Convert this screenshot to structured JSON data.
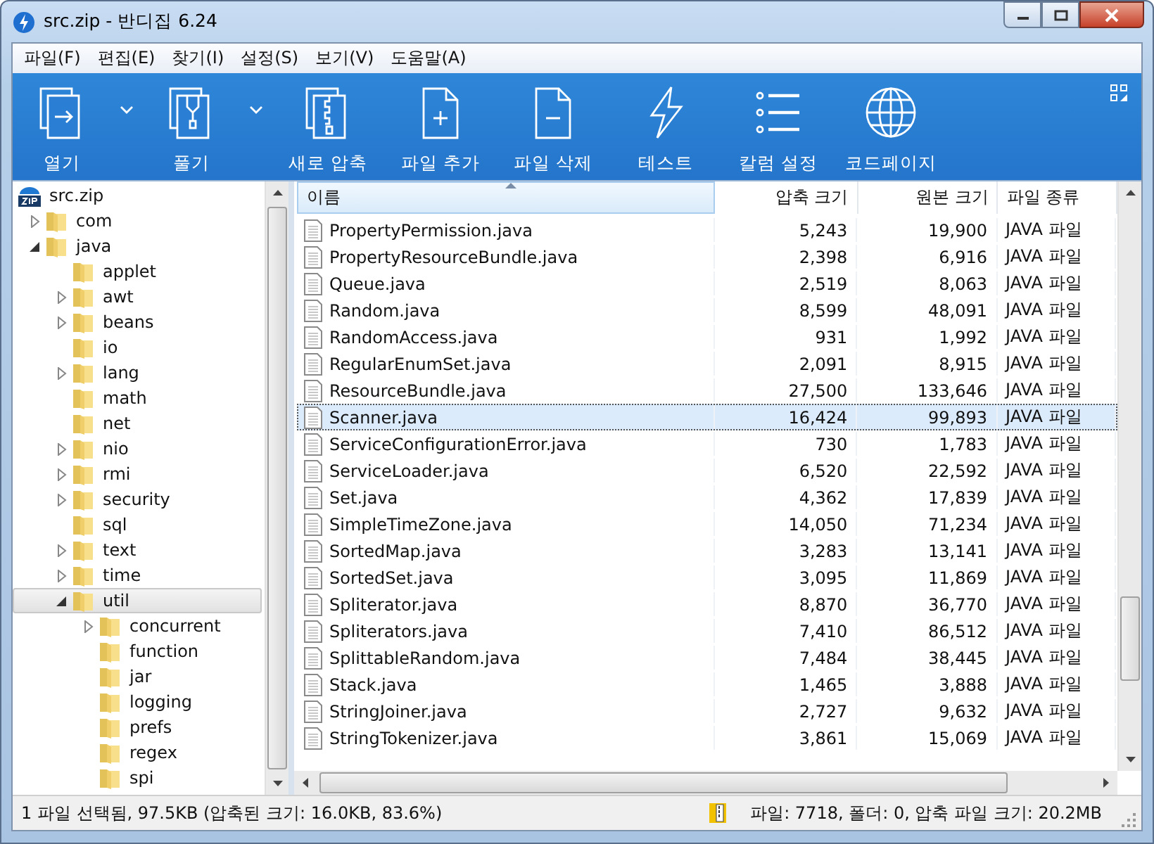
{
  "window": {
    "title": "src.zip - 반디집 6.24"
  },
  "menu": [
    "파일(F)",
    "편집(E)",
    "찾기(I)",
    "설정(S)",
    "보기(V)",
    "도움말(A)"
  ],
  "toolbar": [
    {
      "label": "열기",
      "kind": "open",
      "dropdown": true
    },
    {
      "label": "풀기",
      "kind": "extract",
      "dropdown": true
    },
    {
      "label": "새로 압축",
      "kind": "new",
      "dropdown": false
    },
    {
      "label": "파일 추가",
      "kind": "add",
      "dropdown": false
    },
    {
      "label": "파일 삭제",
      "kind": "delete",
      "dropdown": false
    },
    {
      "label": "테스트",
      "kind": "test",
      "dropdown": false
    },
    {
      "label": "칼럼 설정",
      "kind": "columns",
      "dropdown": false
    },
    {
      "label": "코드페이지",
      "kind": "codepage",
      "dropdown": false
    }
  ],
  "tree": {
    "label": "src.zip",
    "children": [
      {
        "label": "com",
        "has_children": true,
        "expanded": false,
        "selected": false
      },
      {
        "label": "java",
        "has_children": true,
        "expanded": true,
        "selected": false,
        "children": [
          {
            "label": "applet",
            "has_children": false,
            "expanded": false,
            "selected": false
          },
          {
            "label": "awt",
            "has_children": true,
            "expanded": false,
            "selected": false
          },
          {
            "label": "beans",
            "has_children": true,
            "expanded": false,
            "selected": false
          },
          {
            "label": "io",
            "has_children": false,
            "expanded": false,
            "selected": false
          },
          {
            "label": "lang",
            "has_children": true,
            "expanded": false,
            "selected": false
          },
          {
            "label": "math",
            "has_children": false,
            "expanded": false,
            "selected": false
          },
          {
            "label": "net",
            "has_children": false,
            "expanded": false,
            "selected": false
          },
          {
            "label": "nio",
            "has_children": true,
            "expanded": false,
            "selected": false
          },
          {
            "label": "rmi",
            "has_children": true,
            "expanded": false,
            "selected": false
          },
          {
            "label": "security",
            "has_children": true,
            "expanded": false,
            "selected": false
          },
          {
            "label": "sql",
            "has_children": false,
            "expanded": false,
            "selected": false
          },
          {
            "label": "text",
            "has_children": true,
            "expanded": false,
            "selected": false
          },
          {
            "label": "time",
            "has_children": true,
            "expanded": false,
            "selected": false
          },
          {
            "label": "util",
            "has_children": true,
            "expanded": true,
            "selected": true,
            "children": [
              {
                "label": "concurrent",
                "has_children": true,
                "expanded": false,
                "selected": false
              },
              {
                "label": "function",
                "has_children": false,
                "expanded": false,
                "selected": false
              },
              {
                "label": "jar",
                "has_children": false,
                "expanded": false,
                "selected": false
              },
              {
                "label": "logging",
                "has_children": false,
                "expanded": false,
                "selected": false
              },
              {
                "label": "prefs",
                "has_children": false,
                "expanded": false,
                "selected": false
              },
              {
                "label": "regex",
                "has_children": false,
                "expanded": false,
                "selected": false
              },
              {
                "label": "spi",
                "has_children": false,
                "expanded": false,
                "selected": false
              }
            ]
          }
        ]
      }
    ]
  },
  "table": {
    "columns": [
      {
        "label": "이름",
        "sorted": true
      },
      {
        "label": "압축 크기",
        "sorted": false
      },
      {
        "label": "원본 크기",
        "sorted": false
      },
      {
        "label": "파일 종류",
        "sorted": false
      }
    ],
    "rows": [
      {
        "name": "PropertyPermission.java",
        "packed": "5,243",
        "size": "19,900",
        "type": "JAVA 파일",
        "selected": false
      },
      {
        "name": "PropertyResourceBundle.java",
        "packed": "2,398",
        "size": "6,916",
        "type": "JAVA 파일",
        "selected": false
      },
      {
        "name": "Queue.java",
        "packed": "2,519",
        "size": "8,063",
        "type": "JAVA 파일",
        "selected": false
      },
      {
        "name": "Random.java",
        "packed": "8,599",
        "size": "48,091",
        "type": "JAVA 파일",
        "selected": false
      },
      {
        "name": "RandomAccess.java",
        "packed": "931",
        "size": "1,992",
        "type": "JAVA 파일",
        "selected": false
      },
      {
        "name": "RegularEnumSet.java",
        "packed": "2,091",
        "size": "8,915",
        "type": "JAVA 파일",
        "selected": false
      },
      {
        "name": "ResourceBundle.java",
        "packed": "27,500",
        "size": "133,646",
        "type": "JAVA 파일",
        "selected": false
      },
      {
        "name": "Scanner.java",
        "packed": "16,424",
        "size": "99,893",
        "type": "JAVA 파일",
        "selected": true
      },
      {
        "name": "ServiceConfigurationError.java",
        "packed": "730",
        "size": "1,783",
        "type": "JAVA 파일",
        "selected": false
      },
      {
        "name": "ServiceLoader.java",
        "packed": "6,520",
        "size": "22,592",
        "type": "JAVA 파일",
        "selected": false
      },
      {
        "name": "Set.java",
        "packed": "4,362",
        "size": "17,839",
        "type": "JAVA 파일",
        "selected": false
      },
      {
        "name": "SimpleTimeZone.java",
        "packed": "14,050",
        "size": "71,234",
        "type": "JAVA 파일",
        "selected": false
      },
      {
        "name": "SortedMap.java",
        "packed": "3,283",
        "size": "13,141",
        "type": "JAVA 파일",
        "selected": false
      },
      {
        "name": "SortedSet.java",
        "packed": "3,095",
        "size": "11,869",
        "type": "JAVA 파일",
        "selected": false
      },
      {
        "name": "Spliterator.java",
        "packed": "8,870",
        "size": "36,770",
        "type": "JAVA 파일",
        "selected": false
      },
      {
        "name": "Spliterators.java",
        "packed": "7,410",
        "size": "86,512",
        "type": "JAVA 파일",
        "selected": false
      },
      {
        "name": "SplittableRandom.java",
        "packed": "7,484",
        "size": "38,445",
        "type": "JAVA 파일",
        "selected": false
      },
      {
        "name": "Stack.java",
        "packed": "1,465",
        "size": "3,888",
        "type": "JAVA 파일",
        "selected": false
      },
      {
        "name": "StringJoiner.java",
        "packed": "2,727",
        "size": "9,632",
        "type": "JAVA 파일",
        "selected": false
      },
      {
        "name": "StringTokenizer.java",
        "packed": "3,861",
        "size": "15,069",
        "type": "JAVA 파일",
        "selected": false
      }
    ]
  },
  "status_bar": {
    "selection": "1 파일 선택됨, 97.5KB (압축된 크기: 16.0KB, 83.6%)",
    "archive": "파일: 7718, 폴더: 0, 압축 파일 크기: 20.2MB"
  }
}
